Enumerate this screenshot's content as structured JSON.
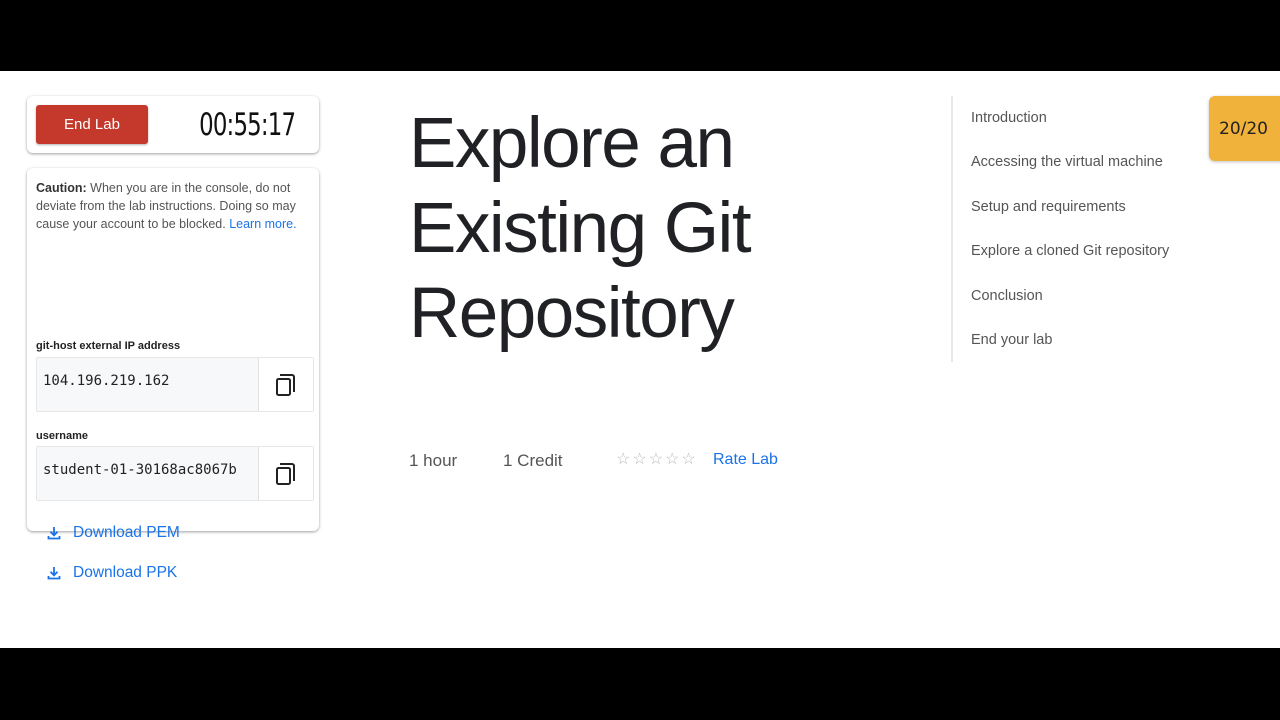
{
  "lab_controls": {
    "end_button_label": "End Lab",
    "timer": "00:55:17"
  },
  "panel": {
    "caution_label": "Caution:",
    "caution_text": " When you are in the console, do not deviate from the lab instructions. Doing so may cause your account to be blocked. ",
    "learn_more": "Learn more.",
    "fields": [
      {
        "label": "git-host external IP address",
        "value": "104.196.219.162"
      },
      {
        "label": "username",
        "value": "student-01-30168ac8067b"
      }
    ],
    "downloads": [
      {
        "label": "Download PEM",
        "icon": "download-icon"
      },
      {
        "label": "Download PPK",
        "icon": "download-icon"
      }
    ]
  },
  "lab": {
    "title": "Explore an Existing Git Repository",
    "duration": "1 hour",
    "credits": "1 Credit",
    "rating_stars": 5,
    "rate_label": "Rate Lab"
  },
  "toc": {
    "items": [
      "Introduction",
      "Accessing the virtual machine",
      "Setup and requirements",
      "Explore a cloned Git repository",
      "Conclusion",
      "End your lab"
    ]
  },
  "score": {
    "value": "20/20"
  },
  "colors": {
    "accent": "#1a73e8",
    "end_button": "#c5392d",
    "score_badge": "#f0b23a"
  }
}
